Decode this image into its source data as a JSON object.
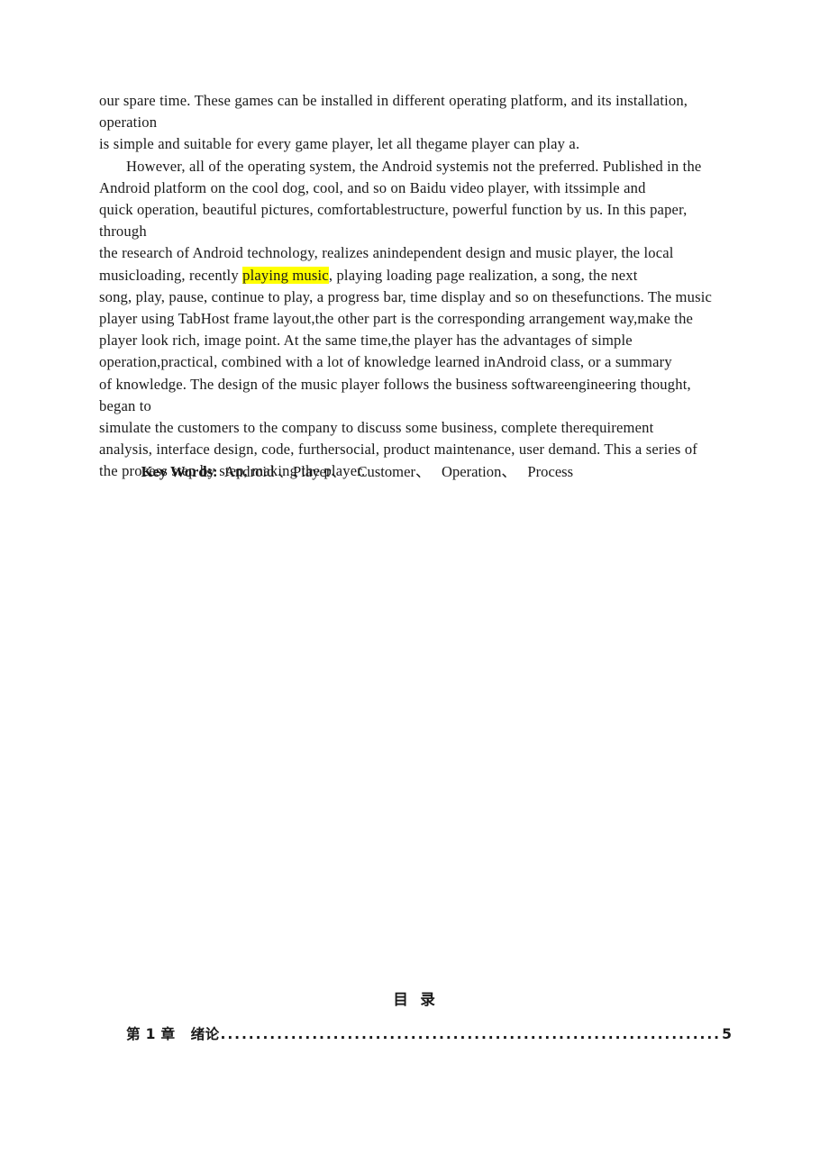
{
  "document": {
    "type": "thesis-abstract-page",
    "background_color": "#ffffff",
    "text_color": "#1a1a1a",
    "highlight_color": "#ffff00"
  },
  "abstract": {
    "lines": [
      {
        "indent": false,
        "segments": [
          {
            "text": "our spare time. These games can be installed in different operating platform, and its installation, operation",
            "highlight": false
          }
        ]
      },
      {
        "indent": false,
        "segments": [
          {
            "text": "is simple and suitable for every game player, let all thegame player can play a.",
            "highlight": false
          }
        ]
      },
      {
        "indent": true,
        "segments": [
          {
            "text": "However, all of the operating system, the Android systemis not the preferred. Published in the",
            "highlight": false
          }
        ]
      },
      {
        "indent": false,
        "segments": [
          {
            "text": "Android platform on the cool dog, cool, and so on Baidu video player, with itssimple and",
            "highlight": false
          }
        ]
      },
      {
        "indent": false,
        "segments": [
          {
            "text": "quick operation, beautiful pictures, comfortablestructure, powerful function by us. In this paper, through",
            "highlight": false
          }
        ]
      },
      {
        "indent": false,
        "segments": [
          {
            "text": "the research of Android technology, realizes anindependent design and music player, the local",
            "highlight": false
          }
        ]
      },
      {
        "indent": false,
        "segments": [
          {
            "text": "musicloading, recently ",
            "highlight": false
          },
          {
            "text": "playing music",
            "highlight": true
          },
          {
            "text": ", playing loading page realization, a song, the next",
            "highlight": false
          }
        ]
      },
      {
        "indent": false,
        "segments": [
          {
            "text": "song, play, pause, continue to play, a progress bar, time display and so on thesefunctions. The music",
            "highlight": false
          }
        ]
      },
      {
        "indent": false,
        "segments": [
          {
            "text": "player using TabHost frame layout,the other part is the corresponding arrangement way,make the",
            "highlight": false
          }
        ]
      },
      {
        "indent": false,
        "segments": [
          {
            "text": "player look rich, image point. At the same time,the player has the advantages of simple",
            "highlight": false
          }
        ]
      },
      {
        "indent": false,
        "segments": [
          {
            "text": "operation,practical, combined with a lot of knowledge learned inAndroid class, or a summary",
            "highlight": false
          }
        ]
      },
      {
        "indent": false,
        "segments": [
          {
            "text": "of knowledge. The design of the music player follows the business softwareengineering thought, began to",
            "highlight": false
          }
        ]
      },
      {
        "indent": false,
        "segments": [
          {
            "text": "simulate the customers to the company to discuss some business, complete therequirement",
            "highlight": false
          }
        ]
      },
      {
        "indent": false,
        "segments": [
          {
            "text": "analysis, interface design, code, furthersocial, product maintenance, user demand. This a series of",
            "highlight": false
          }
        ]
      },
      {
        "indent": false,
        "segments": [
          {
            "text": "the process step by step, making the player.",
            "highlight": false
          }
        ]
      }
    ]
  },
  "keywords": {
    "label": "Key Words:",
    "text": "Android 、Player、   Customer、   Operation、   Process",
    "items": [
      "Android",
      "Player",
      "Customer",
      "Operation",
      "Process"
    ],
    "separator": "、"
  },
  "toc": {
    "heading": "目  录",
    "entries": [
      {
        "title": "第 1 章   绪论",
        "dots": "....................................................................................................",
        "page": "5"
      }
    ]
  }
}
